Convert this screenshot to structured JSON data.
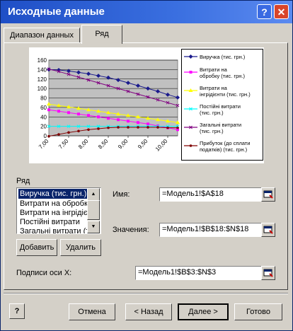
{
  "window": {
    "title": "Исходные данные",
    "help_glyph": "?",
    "close_glyph": "✕"
  },
  "tabs": [
    {
      "label": "Диапазон данных",
      "active": false
    },
    {
      "label": "Ряд",
      "active": true
    }
  ],
  "chart_data": {
    "type": "line",
    "x": [
      "7,00",
      "7,50",
      "8,00",
      "8,50",
      "9,00",
      "9,50",
      "10,00"
    ],
    "ylim": [
      0,
      160
    ],
    "y_ticks": [
      "0",
      "20",
      "40",
      "60",
      "80",
      "100",
      "120",
      "140",
      "160"
    ],
    "x_points": [
      7.0,
      7.25,
      7.5,
      7.75,
      8.0,
      8.25,
      8.5,
      8.75,
      9.0,
      9.25,
      9.5,
      9.75,
      10.0,
      10.25
    ],
    "series": [
      {
        "name": "Виручка (тис. грн.)",
        "color": "#1a1a8c",
        "marker": "diamond",
        "values": [
          140,
          139,
          137,
          134,
          131,
          127,
          123,
          118,
          112,
          106,
          100,
          94,
          87,
          81
        ]
      },
      {
        "name": "Витрати на обробку (тис. грн.)",
        "color": "#ff00ff",
        "marker": "square",
        "values": [
          55,
          52,
          49,
          46,
          43,
          40,
          37,
          34,
          31,
          28,
          25,
          21,
          17,
          13
        ]
      },
      {
        "name": "Витрати на інгрідієнти (тис. грн.)",
        "color": "#ffff00",
        "marker": "triangle",
        "values": [
          67,
          64,
          61,
          58,
          55,
          52,
          49,
          46,
          43,
          40,
          37,
          34,
          31,
          28
        ]
      },
      {
        "name": "Постійні витрати (тис. грн.)",
        "color": "#00ffff",
        "marker": "x",
        "values": [
          20,
          20,
          20,
          20,
          20,
          20,
          20,
          20,
          20,
          20,
          20,
          20,
          20,
          20
        ]
      },
      {
        "name": "Загальні витрати (тис. грн.)",
        "color": "#800080",
        "marker": "star",
        "values": [
          141,
          136,
          130,
          124,
          118,
          112,
          106,
          100,
          94,
          88,
          82,
          76,
          70,
          64
        ]
      },
      {
        "name": "Прибуток (до сплати податків) (тис. грн.)",
        "color": "#800000",
        "marker": "circle",
        "values": [
          -1,
          3,
          7,
          10,
          13,
          15,
          17,
          18,
          18,
          18,
          18,
          18,
          17,
          17
        ]
      }
    ],
    "legend_placement": "right",
    "plot_background": "#c0c0c0"
  },
  "series_group": {
    "label": "Ряд",
    "items": [
      "Виручка (тис. грн.)",
      "Витрати на обробку",
      "Витрати на інгрідієнти",
      "Постійні витрати",
      "Загальні витрати (тис. грн.)"
    ],
    "selected_index": 0,
    "add_label": "Добавить",
    "delete_label": "Удалить"
  },
  "fields": {
    "name_label": "Имя:",
    "name_value": "=Модель1!$A$18",
    "values_label": "Значения:",
    "values_value": "=Модель1!$B$18:$N$18",
    "xaxis_label": "Подписи оси X:",
    "xaxis_value": "=Модель1!$B$3:$N$3"
  },
  "footer": {
    "help_glyph": "?",
    "cancel_label": "Отмена",
    "back_label": "< Назад",
    "next_label": "Далее >",
    "finish_label": "Готово"
  }
}
